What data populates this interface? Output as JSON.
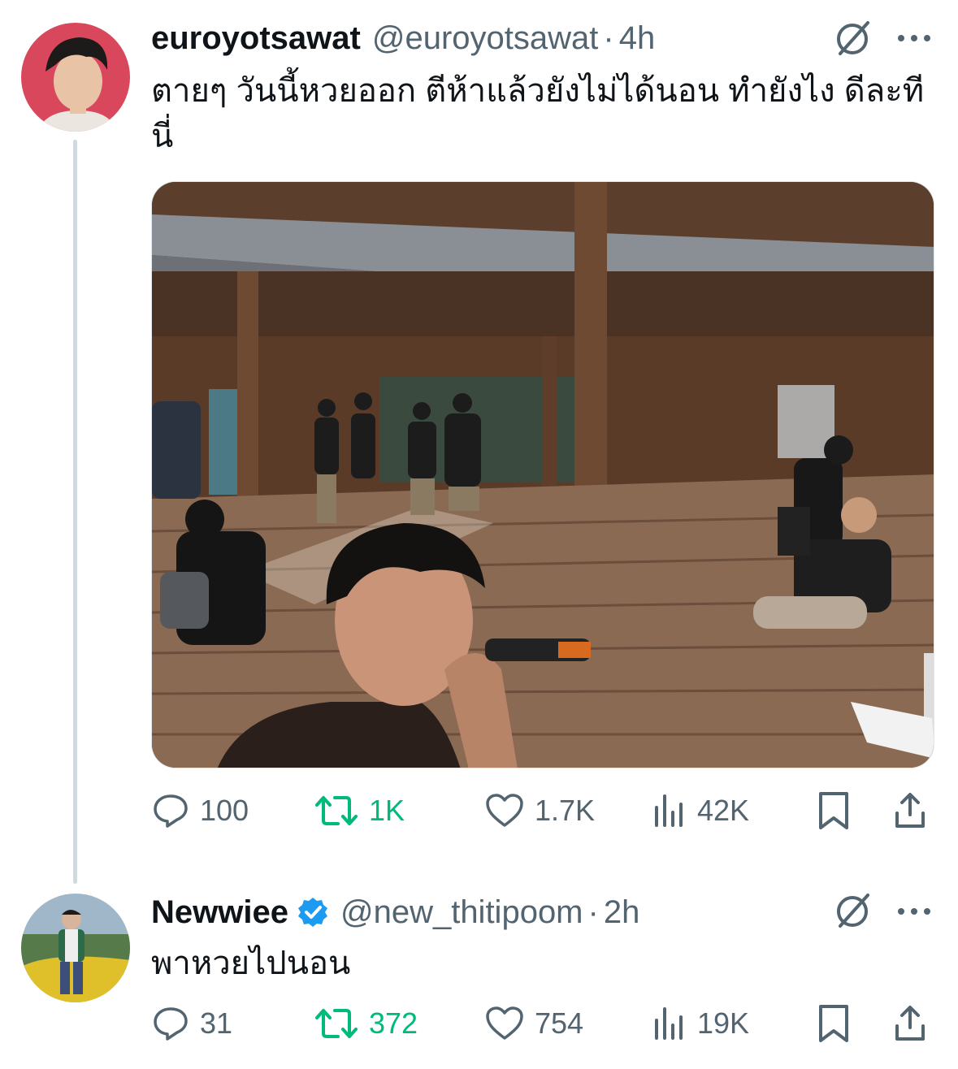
{
  "thread": [
    {
      "display_name": "euroyotsawat",
      "handle": "@euroyotsawat",
      "time": "4h",
      "verified": false,
      "text": "ตายๆ วันนี้หวยออก ตีห้าแล้วยังไม่ได้นอน  ทำยังไง ดีละทีนี่",
      "has_media": true,
      "actions": {
        "replies": "100",
        "retweets": "1K",
        "likes": "1.7K",
        "views": "42K"
      },
      "retweeted": true
    },
    {
      "display_name": "Newwiee",
      "handle": "@new_thitipoom",
      "time": "2h",
      "verified": true,
      "text": "พาหวยไปนอน",
      "has_media": false,
      "actions": {
        "replies": "31",
        "retweets": "372",
        "likes": "754",
        "views": "19K"
      },
      "retweeted": true
    }
  ],
  "icons": {
    "reply": "reply-bubble-icon",
    "retweet": "retweet-icon",
    "like": "heart-icon",
    "views": "views-bars-icon",
    "bookmark": "bookmark-icon",
    "share": "share-upload-icon",
    "grok": "grok-slash-icon",
    "more": "more-dots-icon"
  },
  "colors": {
    "text": "#0f1419",
    "secondary": "#536471",
    "retweet_active": "#00ba7c",
    "verified": "#1d9bf0",
    "thread_line": "#cfd9de"
  }
}
